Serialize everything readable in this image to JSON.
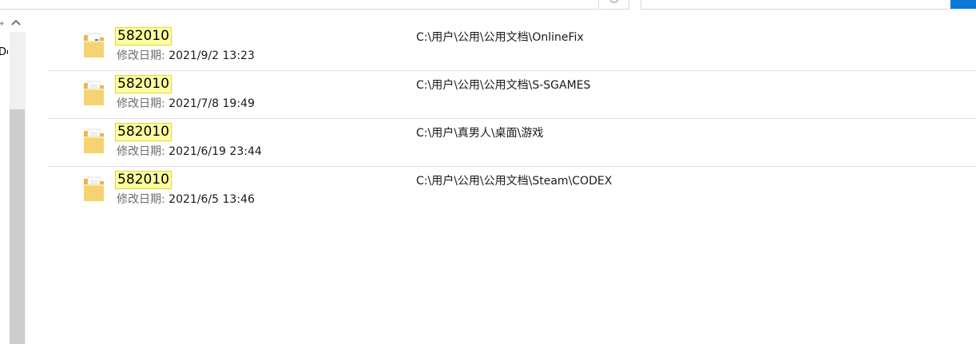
{
  "search_results": [
    {
      "name": "582010",
      "modified_label": "修改日期:",
      "modified_value": "2021/9/2 13:23",
      "path": "C:\\用户\\公用\\公用文档\\OnlineFix",
      "icon": "folder-with-file-icon"
    },
    {
      "name": "582010",
      "modified_label": "修改日期:",
      "modified_value": "2021/7/8 19:49",
      "path": "C:\\用户\\公用\\公用文档\\S-SGAMES",
      "icon": "folder-icon"
    },
    {
      "name": "582010",
      "modified_label": "修改日期:",
      "modified_value": "2021/6/19 23:44",
      "path": "C:\\用户\\真男人\\桌面\\游戏",
      "icon": "folder-icon"
    },
    {
      "name": "582010",
      "modified_label": "修改日期:",
      "modified_value": "2021/6/5 13:46",
      "path": "C:\\用户\\公用\\公用文档\\Steam\\CODEX",
      "icon": "folder-icon"
    }
  ],
  "nav_pane": {
    "partial_label": "De"
  },
  "colors": {
    "highlight_bg": "#ffff9e",
    "highlight_border": "#e6d33c",
    "accent": "#0a78d7",
    "label_gray": "#6d6d6d"
  }
}
